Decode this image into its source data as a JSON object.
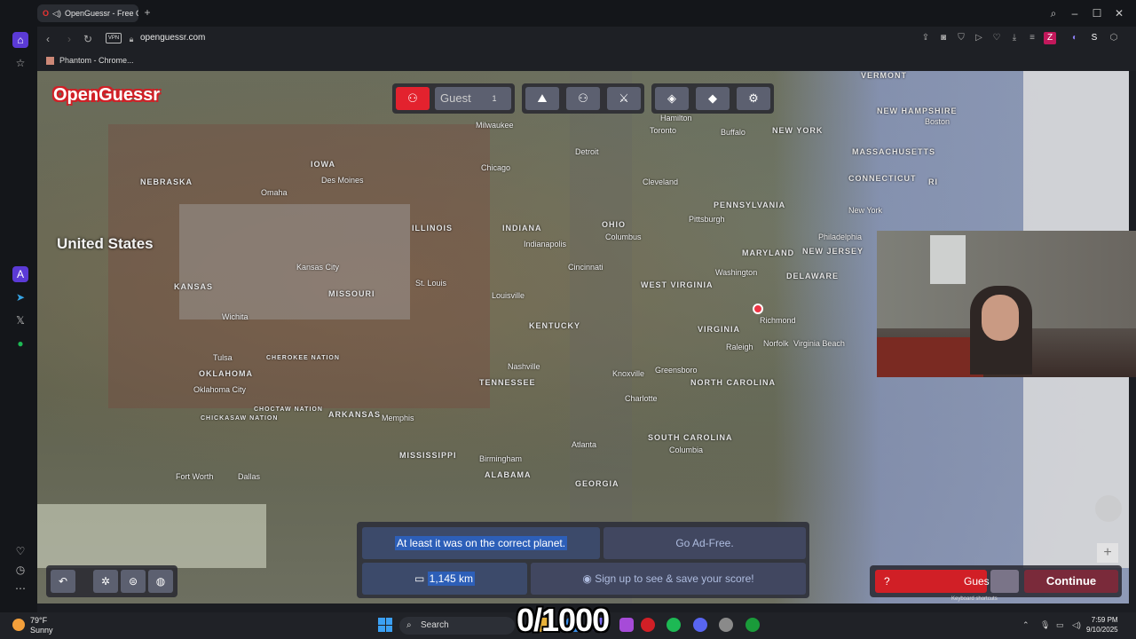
{
  "browser": {
    "tab_title": "OpenGuessr - Free Ge",
    "new_tab_icon": "plus-icon",
    "url": "openguessr.com",
    "vpn_label": "VPN",
    "bookmark_label": "Phantom - Chrome...",
    "profile_letter": "Z"
  },
  "game": {
    "logo": "OpenGuessr",
    "player_name": "Guest",
    "player_count": "1",
    "result_message": "At least it was on the correct planet.",
    "ad_free_label": "Go Ad-Free.",
    "distance": "1,145 km",
    "signup_label": "Sign up to see & save your score!",
    "guess_label": "Gues",
    "guess_help": "?",
    "continue_label": "Continue",
    "keyboard_shortcuts": "Keyboard shortcuts",
    "score_overlay": "0/1000"
  },
  "map": {
    "country": "United States",
    "states": [
      "NEBRASKA",
      "IOWA",
      "ILLINOIS",
      "INDIANA",
      "OHIO",
      "PENNSYLVANIA",
      "NEW YORK",
      "VERMONT",
      "NEW HAMPSHIRE",
      "MASSACHUSETTS",
      "CONNECTICUT",
      "RI",
      "NEW JERSEY",
      "MARYLAND",
      "DELAWARE",
      "WEST VIRGINIA",
      "VIRGINIA",
      "KENTUCKY",
      "MISSOURI",
      "KANSAS",
      "OKLAHOMA",
      "TENNESSEE",
      "NORTH CAROLINA",
      "SOUTH CAROLINA",
      "GEORGIA",
      "ALABAMA",
      "MISSISSIPPI",
      "ARKANSAS",
      "CHEROKEE NATION",
      "CHOCTAW NATION",
      "CHICKASAW NATION"
    ],
    "cities": [
      "Chicago",
      "Detroit",
      "Milwaukee",
      "Cleveland",
      "Columbus",
      "Pittsburgh",
      "Indianapolis",
      "Cincinnati",
      "Louisville",
      "St. Louis",
      "Kansas City",
      "Nashville",
      "Charlotte",
      "Atlanta",
      "Washington",
      "Philadelphia",
      "New York",
      "Boston",
      "Oklahoma City",
      "Dallas",
      "Fort Worth",
      "Richmond",
      "Memphis",
      "Birmingham",
      "Tulsa",
      "Omaha",
      "Des Moines",
      "Wichita",
      "Hamilton",
      "Toronto",
      "Buffalo",
      "Knoxville",
      "Columbia",
      "Norfolk",
      "Virginia Beach",
      "Raleigh",
      "Greensboro"
    ]
  },
  "weather": {
    "temp": "79°F",
    "condition": "Sunny"
  },
  "taskbar": {
    "search_label": "Search"
  },
  "clock": {
    "time": "7:59 PM",
    "date": "9/10/2025"
  },
  "colors": {
    "accent": "#d11f26",
    "panel": "#3c4a6a",
    "ocean": "#8c9bc8"
  }
}
